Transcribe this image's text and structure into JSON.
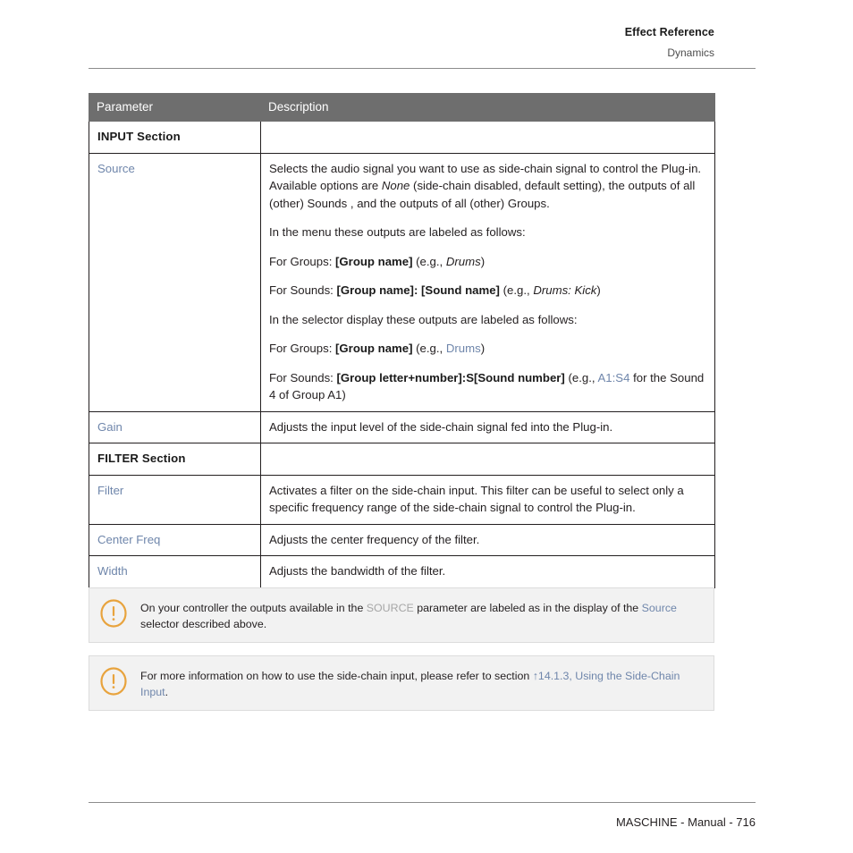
{
  "header": {
    "title": "Effect Reference",
    "subtitle": "Dynamics"
  },
  "table": {
    "columns": [
      "Parameter",
      "Description"
    ],
    "rows": [
      {
        "kind": "section",
        "parameter": "INPUT Section",
        "description": ""
      },
      {
        "kind": "param",
        "parameter": "Source",
        "paragraphs": {
          "p1_a": "Selects the audio signal you want to use as side-chain signal to control the Plug-in. Available options are ",
          "p1_italic": "None",
          "p1_b": " (side-chain disabled, default setting), the outputs of all (other) Sounds , and the outputs of all (other) Groups.",
          "p2": "In the menu these outputs are labeled as follows:",
          "p3_a": "For Groups: ",
          "p3_bold": "[Group name]",
          "p3_b": " (e.g., ",
          "p3_italic": "Drums",
          "p3_c": ")",
          "p4_a": "For Sounds: ",
          "p4_bold": "[Group name]: [Sound name]",
          "p4_b": " (e.g., ",
          "p4_italic": "Drums: Kick",
          "p4_c": ")",
          "p5": "In the selector display these outputs are labeled as follows:",
          "p6_a": "For Groups: ",
          "p6_bold": "[Group name]",
          "p6_b": " (e.g., ",
          "p6_link": "Drums",
          "p6_c": ")",
          "p7_a": "For Sounds: ",
          "p7_bold": "[Group letter+number]:S[Sound number]",
          "p7_b": " (e.g., ",
          "p7_link": "A1:S4",
          "p7_c": " for the Sound 4 of Group A1)"
        }
      },
      {
        "kind": "param",
        "parameter": "Gain",
        "description": "Adjusts the input level of the side-chain signal fed into the Plug-in."
      },
      {
        "kind": "section",
        "parameter": "FILTER Section",
        "description": ""
      },
      {
        "kind": "param",
        "parameter": "Filter",
        "description": "Activates a filter on the side-chain input. This filter can be useful to select only a specific frequency range of the side-chain signal to control the Plug-in."
      },
      {
        "kind": "param",
        "parameter": "Center Freq",
        "description": "Adjusts the center frequency of the filter."
      },
      {
        "kind": "param",
        "parameter": "Width",
        "description": "Adjusts the bandwidth of the filter."
      }
    ]
  },
  "notes": [
    {
      "icon": "exclamation-circle-icon",
      "text_a": "On your controller the outputs available in the ",
      "dim_text": "SOURCE",
      "text_b": " parameter are labeled as in the display of the ",
      "link_text": "Source",
      "text_c": " selector described above."
    },
    {
      "icon": "exclamation-circle-icon",
      "text_a": "For more information on how to use the side-chain input, please refer to section ",
      "link_text": "↑14.1.3, Using the Side-Chain Input",
      "text_c": "."
    }
  ],
  "footer": {
    "text": "MASCHINE - Manual - 716"
  },
  "colors": {
    "link": "#6f86ab",
    "table_header_bg": "#6e6e6e",
    "note_bg": "#f2f2f2",
    "note_icon": "#e8a33d",
    "text": "#231f20"
  }
}
